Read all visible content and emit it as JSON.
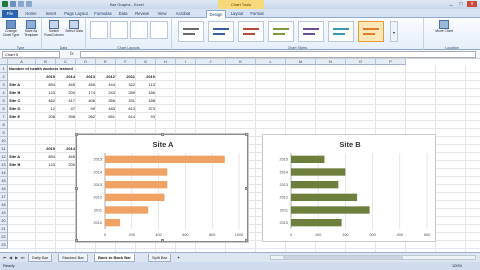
{
  "window": {
    "title": "Bar Graphs - Excel",
    "context_tab": "Chart Tools",
    "controls": [
      "_",
      "□",
      "x"
    ]
  },
  "ribbon_tabs": [
    "File",
    "Home",
    "Insert",
    "Page Layout",
    "Formulas",
    "Data",
    "Review",
    "View",
    "Acrobat",
    "Design",
    "Layout",
    "Format"
  ],
  "ribbon": {
    "groups": [
      {
        "label": "Type",
        "buttons": [
          "Change Chart Type",
          "Save As Template"
        ]
      },
      {
        "label": "Data",
        "buttons": [
          "Switch Row/Column",
          "Select Data"
        ]
      },
      {
        "label": "Chart Layouts",
        "buttons": []
      },
      {
        "label": "Chart Styles",
        "buttons": []
      },
      {
        "label": "Location",
        "buttons": [
          "Move Chart"
        ]
      }
    ]
  },
  "name_box": "Chart 5",
  "fx": "fx",
  "columns": [
    "A",
    "B",
    "C",
    "D",
    "E",
    "F",
    "G",
    "H",
    "I",
    "J",
    "K",
    "L",
    "M",
    "N",
    "O",
    "P"
  ],
  "rows": [
    "1",
    "2",
    "3",
    "4",
    "5",
    "6",
    "7",
    "8",
    "9",
    "10",
    "11",
    "12",
    "13",
    "14",
    "15",
    "16",
    "17",
    "18",
    "19",
    "20",
    "21",
    "22",
    "23"
  ],
  "table": {
    "heading": "Number of health workers trained",
    "years": [
      "2015",
      "2014",
      "2013",
      "2012",
      "2011",
      "2010"
    ],
    "sites": [
      {
        "name": "Site A",
        "values": [
          "894",
          "465",
          "465",
          "444",
          "322",
          "113"
        ]
      },
      {
        "name": "Site B",
        "values": [
          "123",
          "200",
          "174",
          "243",
          "289",
          "186"
        ]
      },
      {
        "name": "Site C",
        "values": [
          "462",
          "417",
          "406",
          "356",
          "331",
          "188"
        ]
      },
      {
        "name": "Site D",
        "values": [
          "12",
          "47",
          "99",
          "483",
          "613",
          "373"
        ]
      },
      {
        "name": "Site E",
        "values": [
          "208",
          "398",
          "262",
          "651",
          "614",
          "93"
        ]
      }
    ]
  },
  "small_table": {
    "years": [
      "2015",
      "2014"
    ],
    "rows": [
      {
        "name": "Site A",
        "values": [
          "894",
          "465"
        ]
      },
      {
        "name": "Site B",
        "values": [
          "123",
          "200"
        ]
      }
    ]
  },
  "chart_data": [
    {
      "type": "bar",
      "orientation": "horizontal",
      "title": "Site A",
      "categories": [
        "2010",
        "2011",
        "2012",
        "2013",
        "2014",
        "2015"
      ],
      "values": [
        113,
        322,
        444,
        465,
        465,
        894
      ],
      "xticks": [
        "0",
        "200",
        "400",
        "600",
        "800",
        "1000"
      ],
      "xlim": [
        0,
        1000
      ],
      "grid": true,
      "color": "#f0a164"
    },
    {
      "type": "bar",
      "orientation": "horizontal",
      "title": "Site B",
      "categories": [
        "2010",
        "2011",
        "2012",
        "2013",
        "2014",
        "2015"
      ],
      "values": [
        186,
        289,
        243,
        174,
        200,
        123
      ],
      "xticks": [
        "0",
        "100",
        "200",
        "300",
        "400",
        "500"
      ],
      "xlim": [
        0,
        500
      ],
      "grid": true,
      "color": "#6e7f3d"
    }
  ],
  "sheet_tabs": [
    "Daily Bar",
    "Stacked Bar",
    "Back to Back Bar",
    "Split Bar"
  ],
  "active_sheet": "Back to Back Bar",
  "status": {
    "left": "Ready",
    "zoom": "100%"
  }
}
